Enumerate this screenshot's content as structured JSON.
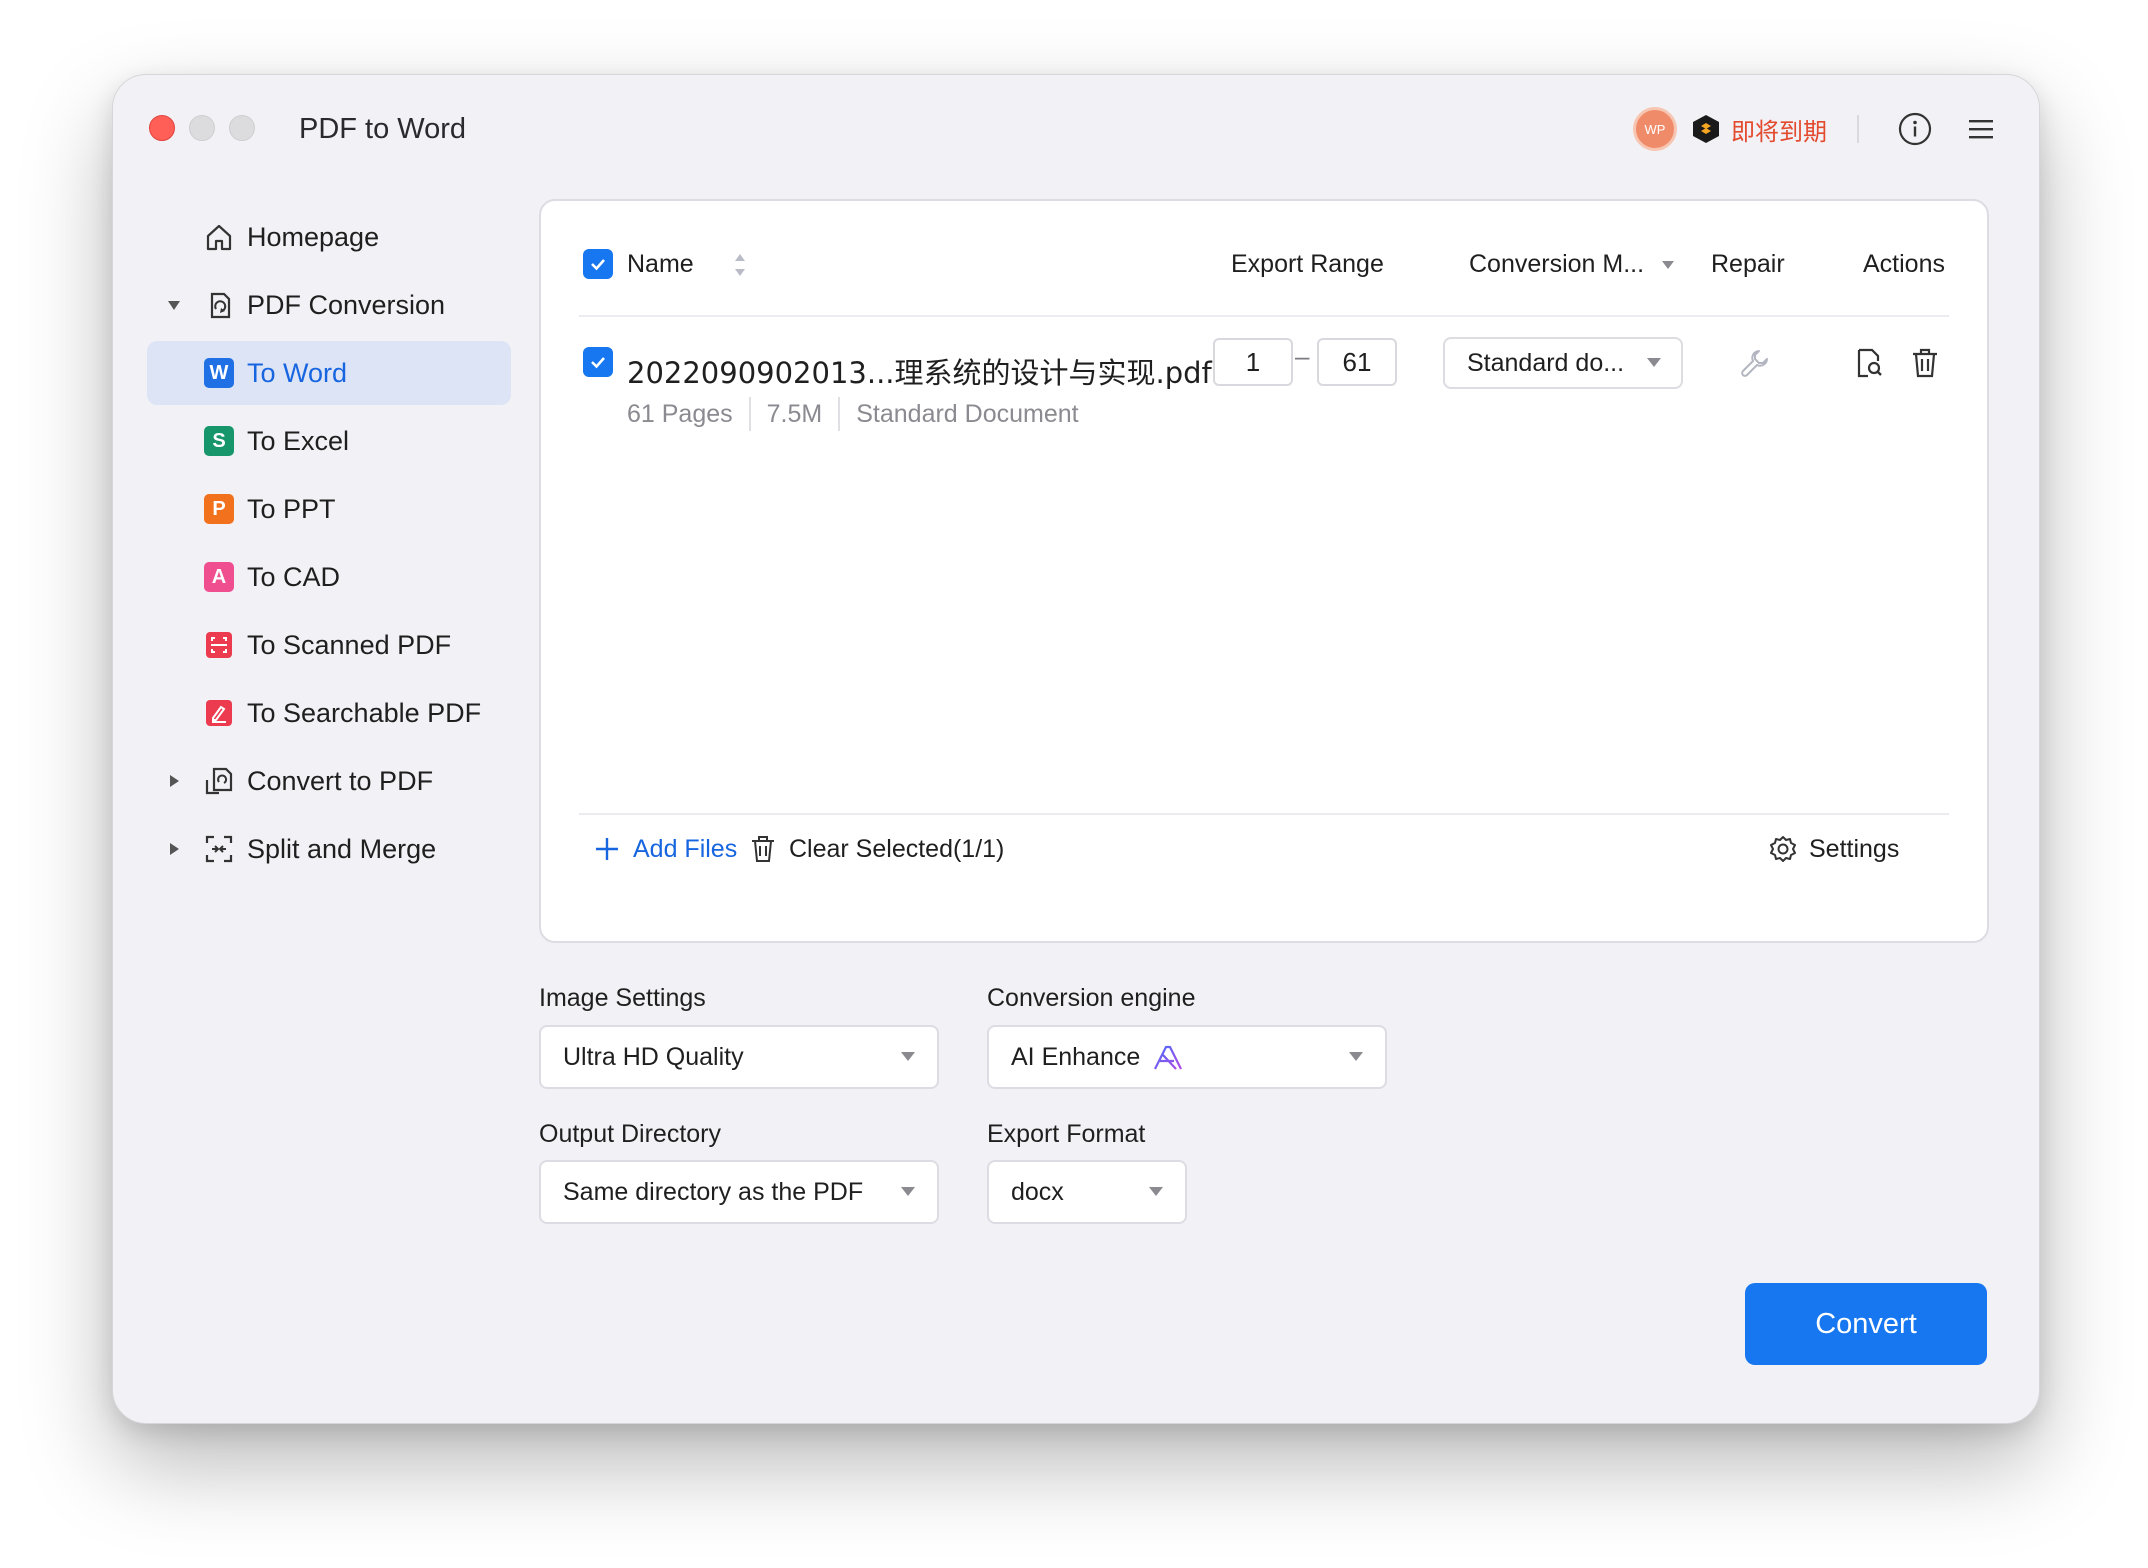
{
  "window": {
    "title": "PDF to Word",
    "avatar_text": "WP",
    "status_text": "即将到期",
    "colors": {
      "accent": "#1677f0",
      "status": "#e34a2e",
      "active_bg": "#dde4f5"
    }
  },
  "sidebar": {
    "items": [
      {
        "label": "Homepage",
        "icon": "home-icon"
      },
      {
        "label": "PDF Conversion",
        "icon": "pdf-conversion-icon",
        "expanded": true
      },
      {
        "label": "To Word",
        "icon": "word-icon",
        "badge": "W",
        "active": true
      },
      {
        "label": "To Excel",
        "icon": "excel-icon",
        "badge": "S"
      },
      {
        "label": "To PPT",
        "icon": "ppt-icon",
        "badge": "P"
      },
      {
        "label": "To CAD",
        "icon": "cad-icon",
        "badge": "A"
      },
      {
        "label": "To Scanned PDF",
        "icon": "scanned-pdf-icon"
      },
      {
        "label": "To Searchable PDF",
        "icon": "searchable-pdf-icon"
      },
      {
        "label": "Convert to PDF",
        "icon": "convert-to-pdf-icon",
        "expanded": false
      },
      {
        "label": "Split and Merge",
        "icon": "split-merge-icon",
        "expanded": false
      }
    ]
  },
  "table": {
    "headers": {
      "name": "Name",
      "export_range": "Export Range",
      "conversion_mode": "Conversion M...",
      "repair": "Repair",
      "actions": "Actions"
    },
    "select_all_checked": true,
    "files": [
      {
        "name": "2022090902013...理系统的设计与实现.pdf",
        "pages": "61 Pages",
        "size": "7.5M",
        "doc_type": "Standard Document",
        "range_from": "1",
        "range_to": "61",
        "range_separator": "–",
        "mode": "Standard do...",
        "checked": true
      }
    ],
    "footer": {
      "add_files": "Add Files",
      "clear_selected": "Clear Selected(1/1)",
      "settings": "Settings"
    }
  },
  "settings": {
    "image_settings": {
      "label": "Image Settings",
      "value": "Ultra HD Quality"
    },
    "conversion_engine": {
      "label": "Conversion engine",
      "value": "AI Enhance"
    },
    "output_directory": {
      "label": "Output Directory",
      "value": "Same directory as the PDF"
    },
    "export_format": {
      "label": "Export Format",
      "value": "docx"
    }
  },
  "convert_button": "Convert"
}
